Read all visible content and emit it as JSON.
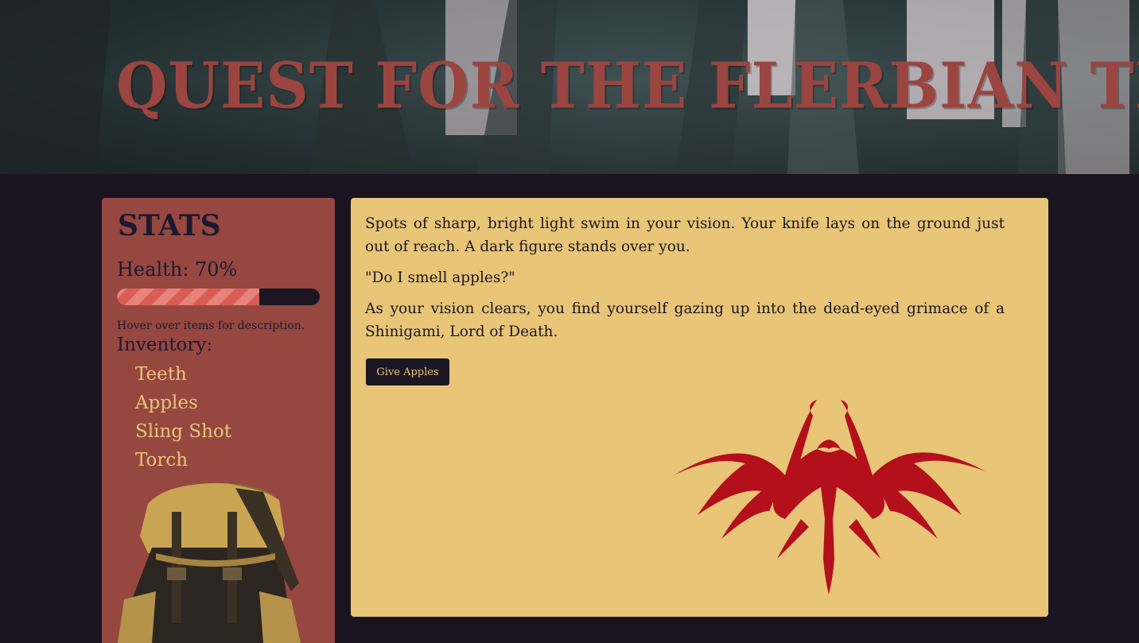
{
  "header": {
    "title": "Quest for the Flerbian Texts"
  },
  "sidebar": {
    "heading": "Stats",
    "health_label": "Health: 70%",
    "health_value": 0.7,
    "hint": "Hover over items for description.",
    "inventory_title": "Inventory:",
    "items": [
      "Teeth",
      "Apples",
      "Sling Shot",
      "Torch"
    ]
  },
  "story": {
    "paragraphs": [
      "Spots of sharp, bright light swim in your vision. Your knife lays on the ground just out of reach. A dark figure stands over you.",
      "\"Do I smell apples?\"",
      "As your vision clears, you find yourself gazing up into the dead-eyed grimace of a Shinigami, Lord of Death."
    ],
    "button_label": "Give Apples"
  },
  "colors": {
    "background": "#1a1420",
    "sidebar": "#964740",
    "story_panel": "#e8c577",
    "title": "#9a4540",
    "health_fill": "#d95c57",
    "inventory_text": "#e9c47a"
  },
  "icons": {
    "backpack": "backpack-icon",
    "shinigami": "shinigami-silhouette-icon"
  }
}
